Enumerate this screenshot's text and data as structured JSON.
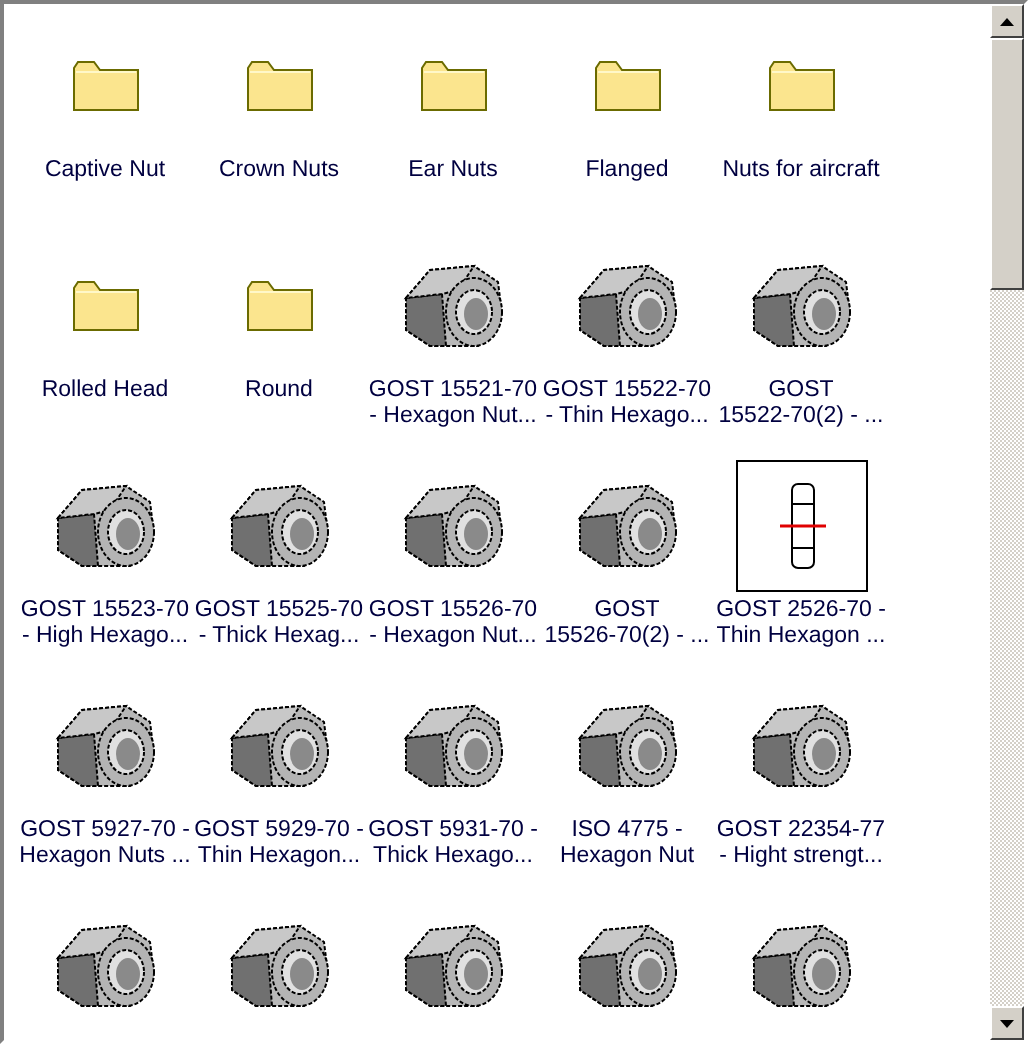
{
  "items": [
    {
      "kind": "folder",
      "label": "Captive Nut"
    },
    {
      "kind": "folder",
      "label": "Crown Nuts"
    },
    {
      "kind": "folder",
      "label": "Ear Nuts"
    },
    {
      "kind": "folder",
      "label": "Flanged"
    },
    {
      "kind": "folder",
      "label": "Nuts for aircraft"
    },
    {
      "kind": "folder",
      "label": "Rolled Head"
    },
    {
      "kind": "folder",
      "label": "Round"
    },
    {
      "kind": "nut",
      "label": "GOST 15521-70\n- Hexagon Nut..."
    },
    {
      "kind": "nut",
      "label": "GOST 15522-70\n- Thin Hexago..."
    },
    {
      "kind": "nut",
      "label": "GOST\n15522-70(2) - ..."
    },
    {
      "kind": "nut",
      "label": "GOST 15523-70\n- High Hexago..."
    },
    {
      "kind": "nut",
      "label": "GOST 15525-70\n- Thick Hexag..."
    },
    {
      "kind": "nut",
      "label": "GOST 15526-70\n- Hexagon Nut..."
    },
    {
      "kind": "nut",
      "label": "GOST\n15526-70(2) - ..."
    },
    {
      "kind": "sketch",
      "label": "GOST 2526-70 -\nThin Hexagon ..."
    },
    {
      "kind": "nut",
      "label": "GOST 5927-70 -\nHexagon Nuts ..."
    },
    {
      "kind": "nut",
      "label": "GOST 5929-70 -\nThin Hexagon..."
    },
    {
      "kind": "nut",
      "label": "GOST 5931-70 -\nThick Hexago..."
    },
    {
      "kind": "nut",
      "label": "ISO 4775 -\nHexagon Nut"
    },
    {
      "kind": "nut",
      "label": "GOST 22354-77\n- Hight strengt..."
    },
    {
      "kind": "nut"
    },
    {
      "kind": "nut"
    },
    {
      "kind": "nut"
    },
    {
      "kind": "nut"
    },
    {
      "kind": "nut"
    }
  ]
}
